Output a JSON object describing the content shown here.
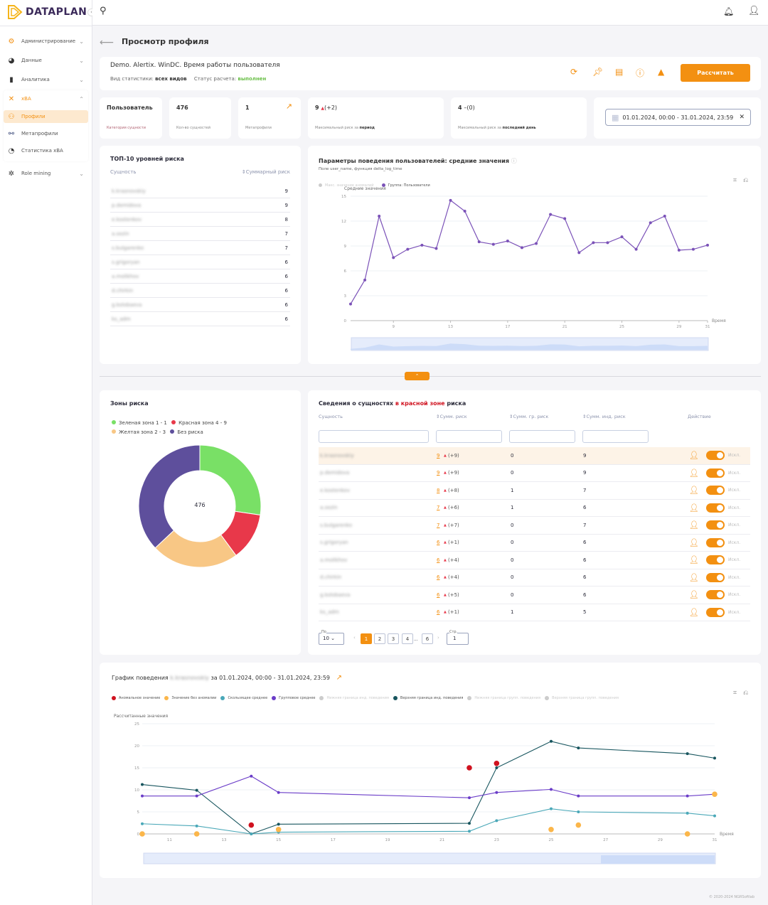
{
  "app": {
    "logo_text": "DATAPLAN",
    "footer": "© 2020-2024 NGRSoftlab"
  },
  "sidebar": {
    "items": [
      {
        "label": "Администрирование",
        "icon": "gear-icon"
      },
      {
        "label": "Данные",
        "icon": "pie-icon"
      },
      {
        "label": "Аналитика",
        "icon": "bar-chart-icon"
      },
      {
        "label": "xBA",
        "icon": "xba-icon",
        "expanded": true
      },
      {
        "label": "Профили",
        "icon": "profiles-icon",
        "active": true
      },
      {
        "label": "Метапрофили",
        "icon": "metaprofiles-icon"
      },
      {
        "label": "Статистика xBA",
        "icon": "stats-icon"
      },
      {
        "label": "Role mining",
        "icon": "role-mining-icon"
      }
    ]
  },
  "page": {
    "title": "Просмотр профиля"
  },
  "profile": {
    "name": "Demo. Alertix. WinDC. Время работы пользователя",
    "stat_type_label": "Вид статистики:",
    "stat_type_value": "всех видов",
    "status_label": "Статус расчета:",
    "status_value": "выполнен",
    "calculate_button": "Рассчитать",
    "accent": "#f39011",
    "status_color": "#6cc04a"
  },
  "stats": [
    {
      "value": "Пользователь",
      "label": "Категория сущности"
    },
    {
      "value": "476",
      "label": "Кол-во сущностей"
    },
    {
      "value": "1",
      "label": "Метапрофили"
    },
    {
      "value": "9",
      "delta": "(+2)",
      "label": "Максимальный риск за",
      "label_bold": "период"
    },
    {
      "value": "4",
      "delta": "(0)",
      "label": "Максимальный риск за",
      "label_bold": "последний день"
    }
  ],
  "date_range": "01.01.2024, 00:00 - 31.01.2024, 23:59",
  "top10": {
    "title": "ТОП-10 уровней риска",
    "col_entity": "Сущность",
    "col_risk": "Суммарный риск",
    "rows": [
      {
        "name": "k.krasnovskiy",
        "risk": "9"
      },
      {
        "name": "p.demidova",
        "risk": "9"
      },
      {
        "name": "e.kostenkov",
        "risk": "8"
      },
      {
        "name": "a.sozin",
        "risk": "7"
      },
      {
        "name": "s.bulgarenko",
        "risk": "7"
      },
      {
        "name": "s.grigoryan",
        "risk": "6"
      },
      {
        "name": "a.molikhov",
        "risk": "6"
      },
      {
        "name": "d.chirkin",
        "risk": "6"
      },
      {
        "name": "g.kolobaeva",
        "risk": "6"
      },
      {
        "name": "ks_adm",
        "risk": "6"
      }
    ]
  },
  "chart_data": [
    {
      "type": "line",
      "title": "Параметры поведения пользователей: средние значения",
      "subtitle": "Поле user_name, функция delta_log_time",
      "ylabel": "Средние значения",
      "xlabel": "Время",
      "ylim": [
        0,
        15
      ],
      "yticks": [
        "0",
        "3",
        "6",
        "9",
        "12",
        "15"
      ],
      "xticks": [
        "9",
        "13",
        "17",
        "21",
        "25",
        "29",
        "31"
      ],
      "legend": [
        "Макс. значение аномалий",
        "Группа: Пользователи"
      ],
      "x": [
        6,
        7,
        8,
        9,
        10,
        11,
        12,
        13,
        14,
        15,
        16,
        17,
        18,
        19,
        20,
        21,
        22,
        23,
        24,
        25,
        26,
        27,
        28,
        29,
        30,
        31
      ],
      "series": [
        {
          "name": "Группа: Пользователи",
          "color": "#7b52b8",
          "values": [
            2,
            4.9,
            12.6,
            7.6,
            8.6,
            9.1,
            8.7,
            14.5,
            13.2,
            9.5,
            9.2,
            9.6,
            8.8,
            9.3,
            12.8,
            12.3,
            8.2,
            9.4,
            9.4,
            10.1,
            8.6,
            11.8,
            12.6,
            8.5,
            8.6,
            9.1
          ]
        }
      ]
    },
    {
      "type": "pie",
      "title": "Зоны риска",
      "center_label": "476",
      "slices": [
        {
          "name": "Зеленая зона 1 - 1",
          "value": 130,
          "color": "#79e066"
        },
        {
          "name": "Красная зона 4 - 9",
          "value": 60,
          "color": "#e8384a"
        },
        {
          "name": "Желтая зона 2 - 3",
          "value": 110,
          "color": "#f8c785"
        },
        {
          "name": "Без риска",
          "value": 176,
          "color": "#5e4f9c"
        }
      ]
    },
    {
      "type": "line",
      "title_prefix": "График поведения",
      "title_entity": "k.krasnovskiy",
      "title_suffix": "за 01.01.2024, 00:00 - 31.01.2024, 23:59",
      "ylabel": "Рассчитанные значения",
      "xlabel": "Время",
      "ylim": [
        0,
        25
      ],
      "yticks": [
        "0",
        "5",
        "10",
        "15",
        "20",
        "25"
      ],
      "xticks": [
        "11",
        "13",
        "15",
        "17",
        "19",
        "21",
        "23",
        "25",
        "27",
        "29",
        "31"
      ],
      "legend": [
        {
          "name": "Аномальное значение",
          "color": "#d0121f",
          "enabled": true
        },
        {
          "name": "Значение без аномалии",
          "color": "#fbb64a",
          "enabled": true
        },
        {
          "name": "Скользящее среднее",
          "color": "#4aa8b8",
          "enabled": true
        },
        {
          "name": "Групповое среднее",
          "color": "#6a3cc8",
          "enabled": true
        },
        {
          "name": "Нижняя граница инд. поведения",
          "color": "#cccccc",
          "enabled": false
        },
        {
          "name": "Верхняя граница инд. поведения",
          "color": "#17555e",
          "enabled": true
        },
        {
          "name": "Нижняя граница групп. поведения",
          "color": "#cccccc",
          "enabled": false
        },
        {
          "name": "Верхняя граница групп. поведения",
          "color": "#cccccc",
          "enabled": false
        }
      ],
      "x": [
        10,
        12,
        14,
        15,
        22,
        23,
        25,
        26,
        30,
        31
      ],
      "series": [
        {
          "name": "Верхняя граница инд. поведения",
          "color": "#17555e",
          "values": [
            11.2,
            9.9,
            0,
            2.2,
            2.4,
            15,
            21,
            19.5,
            18.2,
            17.2
          ]
        },
        {
          "name": "Групповое среднее",
          "color": "#6a3cc8",
          "values": [
            8.6,
            8.6,
            13.1,
            9.4,
            8.2,
            9.4,
            10.1,
            8.6,
            8.6,
            9.0
          ]
        },
        {
          "name": "Скользящее среднее",
          "color": "#4aa8b8",
          "values": [
            2.3,
            1.8,
            0,
            0.4,
            0.6,
            3.0,
            5.7,
            5.0,
            4.7,
            4.1
          ]
        }
      ],
      "points": [
        {
          "name": "Аномальное значение",
          "color": "#d0121f",
          "x": [
            14,
            22,
            23
          ],
          "y": [
            2,
            15,
            16
          ]
        },
        {
          "name": "Значение без аномалии",
          "color": "#fbb64a",
          "x": [
            10,
            12,
            15,
            25,
            26,
            30,
            31
          ],
          "y": [
            0,
            0,
            1,
            1,
            2,
            0,
            9
          ]
        }
      ]
    }
  ],
  "zones": {
    "title": "Зоны риска"
  },
  "red_table": {
    "title_a": "Сведения о сущностях",
    "title_b": "в красной зоне",
    "title_c": "риска",
    "cols": [
      "Сущность",
      "Сумм. риск",
      "Сумм. гр. риск",
      "Сумм. инд. риск",
      "Действие"
    ],
    "exclude_label": "Искл.",
    "rows": [
      {
        "name": "k.krasnovskiy",
        "risk": "9",
        "delta": "(+9)",
        "group": "0",
        "ind": "9"
      },
      {
        "name": "p.demidova",
        "risk": "9",
        "delta": "(+9)",
        "group": "0",
        "ind": "9"
      },
      {
        "name": "e.kostenkov",
        "risk": "8",
        "delta": "(+8)",
        "group": "1",
        "ind": "7"
      },
      {
        "name": "a.sozin",
        "risk": "7",
        "delta": "(+6)",
        "group": "1",
        "ind": "6"
      },
      {
        "name": "s.bulgarenko",
        "risk": "7",
        "delta": "(+7)",
        "group": "0",
        "ind": "7"
      },
      {
        "name": "s.grigoryan",
        "risk": "6",
        "delta": "(+1)",
        "group": "0",
        "ind": "6"
      },
      {
        "name": "a.molikhov",
        "risk": "6",
        "delta": "(+4)",
        "group": "0",
        "ind": "6"
      },
      {
        "name": "d.chirkin",
        "risk": "6",
        "delta": "(+4)",
        "group": "0",
        "ind": "6"
      },
      {
        "name": "g.kolobaeva",
        "risk": "6",
        "delta": "(+5)",
        "group": "0",
        "ind": "6"
      },
      {
        "name": "ks_adm",
        "risk": "6",
        "delta": "(+1)",
        "group": "1",
        "ind": "5"
      }
    ],
    "pagination": {
      "per_page_label": "По",
      "per_page": "10",
      "pages": [
        "1",
        "2",
        "3",
        "4",
        "6"
      ],
      "ellipsis": "...",
      "page_label": "Стр.",
      "page_value": "1"
    }
  }
}
